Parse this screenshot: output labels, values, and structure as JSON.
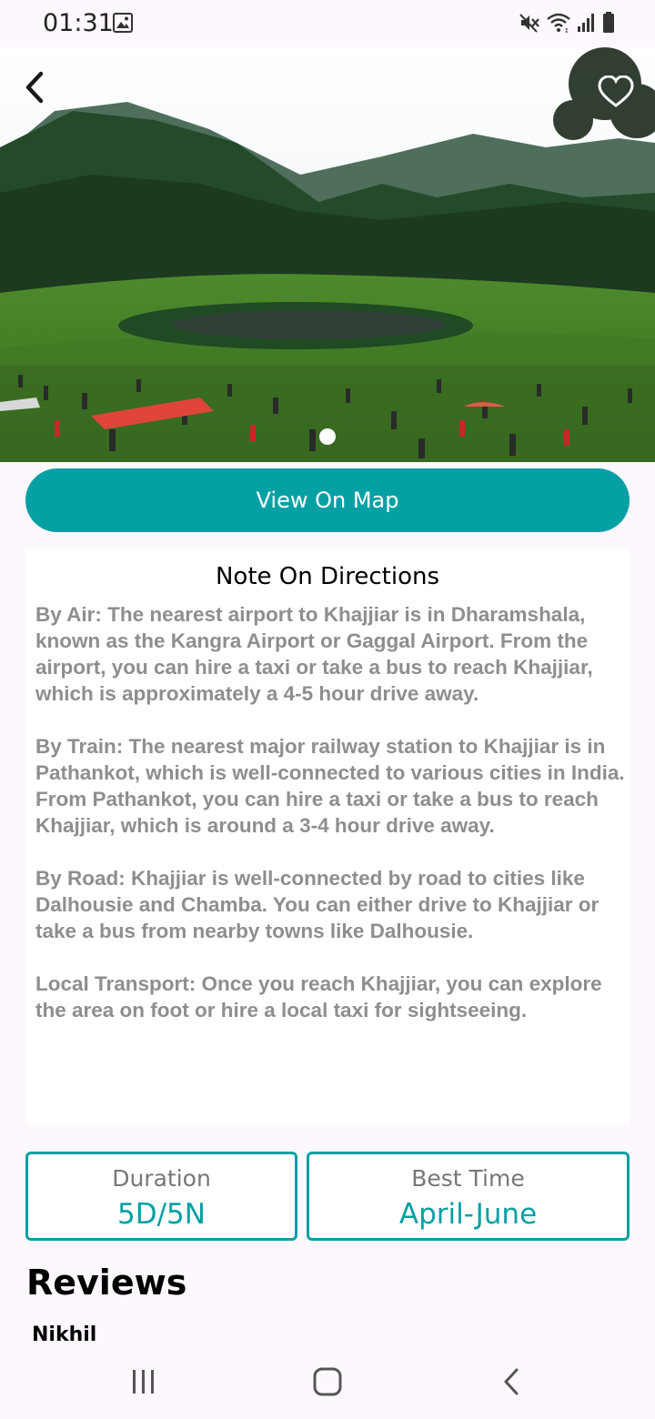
{
  "status": {
    "time": "01:31",
    "icons": [
      "gallery-icon",
      "mute-icon",
      "wifi-icon",
      "signal-icon",
      "battery-icon"
    ]
  },
  "hero": {
    "image": "Meadow with lake surrounded by forested hills and crowds of people",
    "slide_index": 1,
    "slide_count": 1
  },
  "actions": {
    "view_map_label": "View On Map"
  },
  "notes": {
    "title": "Note On Directions",
    "paragraphs": [
      "By Air: The nearest airport to Khajjiar is in Dharamshala, known as the Kangra Airport or Gaggal Airport. From the airport, you can hire a taxi or take a bus to reach Khajjiar, which is approximately a 4-5 hour drive away.",
      "By Train: The nearest major railway station to Khajjiar is in Pathankot, which is well-connected to various cities in India. From Pathankot, you can hire a taxi or take a bus to reach Khajjiar, which is around a 3-4 hour drive away.",
      "By Road: Khajjiar is well-connected by road to cities like Dalhousie and Chamba. You can either drive to Khajjiar or take a bus from nearby towns like Dalhousie.",
      "Local Transport: Once you reach Khajjiar, you can explore the area on foot or hire a local taxi for sightseeing."
    ]
  },
  "info": {
    "duration_label": "Duration",
    "duration_value": "5D/5N",
    "best_time_label": "Best Time",
    "best_time_value": "April-June"
  },
  "reviews": {
    "title": "Reviews",
    "items": [
      {
        "name": "Nikhil"
      }
    ]
  },
  "colors": {
    "accent": "#05a0a4",
    "background": "#fdf7fe",
    "card": "#ffffff",
    "muted_text": "#8e8e8e"
  }
}
